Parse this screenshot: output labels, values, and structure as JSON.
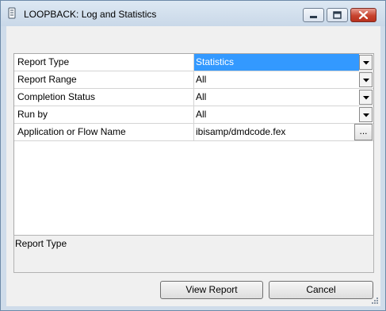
{
  "window": {
    "title": "LOOPBACK: Log and Statistics"
  },
  "properties": [
    {
      "label": "Report Type",
      "value": "Statistics",
      "control": "dropdown",
      "selected": true
    },
    {
      "label": "Report Range",
      "value": "All",
      "control": "dropdown",
      "selected": false
    },
    {
      "label": "Completion Status",
      "value": "All",
      "control": "dropdown",
      "selected": false
    },
    {
      "label": "Run by",
      "value": "All",
      "control": "dropdown",
      "selected": false
    },
    {
      "label": "Application or Flow Name",
      "value": "ibisamp/dmdcode.fex",
      "control": "browse",
      "selected": false
    }
  ],
  "browse_button_label": "...",
  "description": {
    "text": "Report Type"
  },
  "buttons": {
    "view_report": "View Report",
    "cancel": "Cancel"
  },
  "colors": {
    "selection": "#3399ff",
    "close_button": "#c7432f"
  }
}
